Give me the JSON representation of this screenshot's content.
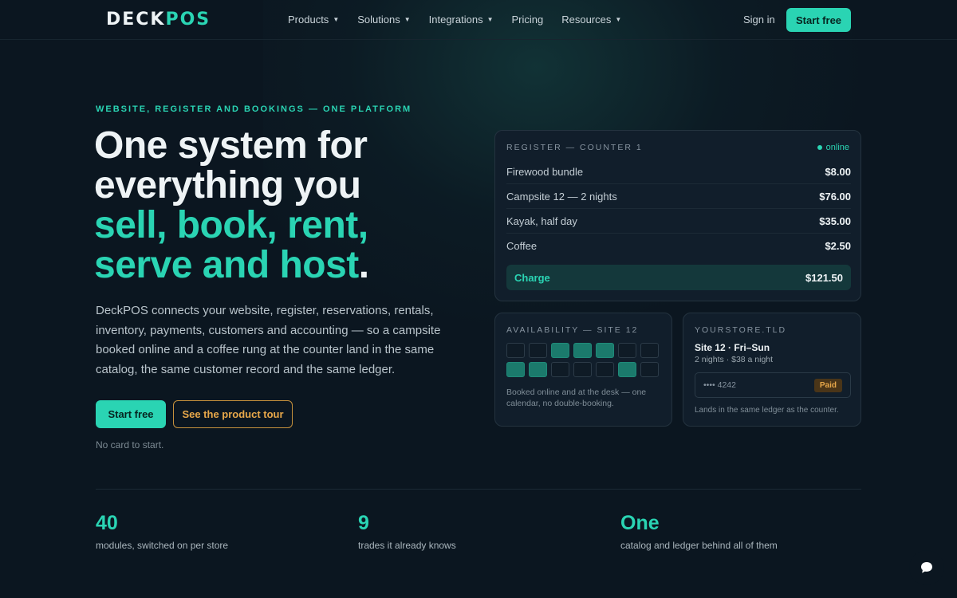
{
  "nav": {
    "logo_a": "DECK",
    "logo_b": "POS",
    "items": [
      {
        "label": "Products",
        "caret": true
      },
      {
        "label": "Solutions",
        "caret": true
      },
      {
        "label": "Integrations",
        "caret": true
      },
      {
        "label": "Pricing",
        "caret": false
      },
      {
        "label": "Resources",
        "caret": true
      }
    ],
    "signin": "Sign in",
    "start": "Start free"
  },
  "hero": {
    "eyebrow": "WEBSITE, REGISTER AND BOOKINGS — ONE PLATFORM",
    "line1": "One system for",
    "line2": "everything you",
    "line3": "sell, book, rent,",
    "line4": "serve and host",
    "dot": ".",
    "lede": "DeckPOS connects your website, register, reservations, rentals, inventory, payments, customers and accounting — so a campsite booked online and a coffee rung at the counter land in the same catalog, the same customer record and the same ledger.",
    "start": "Start free",
    "tour": "See the product tour",
    "nocard": "No card to start."
  },
  "register": {
    "label": "REGISTER — COUNTER 1",
    "status": "online",
    "items": [
      {
        "name": "Firewood bundle",
        "price": "$8.00"
      },
      {
        "name": "Campsite 12 — 2 nights",
        "price": "$76.00"
      },
      {
        "name": "Kayak, half day",
        "price": "$35.00"
      },
      {
        "name": "Coffee",
        "price": "$2.50"
      }
    ],
    "charge_label": "Charge",
    "charge_total": "$121.50"
  },
  "availability": {
    "label": "AVAILABILITY — SITE 12",
    "cells": [
      0,
      0,
      1,
      1,
      1,
      0,
      0,
      1,
      1,
      0,
      0,
      0,
      1,
      0
    ],
    "note": "Booked online and at the desk — one calendar, no double-booking."
  },
  "store": {
    "label": "YOURSTORE.TLD",
    "site": "Site 12 · Fri–Sun",
    "sub": "2 nights · $38 a night",
    "card": "•••• 4242",
    "paid": "Paid",
    "note": "Lands in the same ledger as the counter."
  },
  "stats": [
    {
      "num": "40",
      "cap": "modules, switched on per store"
    },
    {
      "num": "9",
      "cap": "trades it already knows"
    },
    {
      "num": "One",
      "cap": "catalog and ledger behind all of them"
    }
  ],
  "colors": {
    "accent": "#2ad4b3",
    "secondary": "#e8a84a",
    "bg": "#0b1620"
  }
}
